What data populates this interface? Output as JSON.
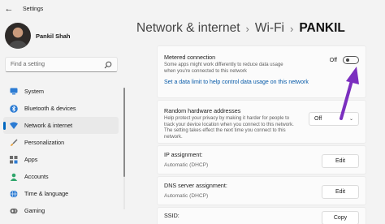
{
  "window": {
    "title": "Settings",
    "back_icon": "back-arrow-icon"
  },
  "profile": {
    "name": "Pankil Shah"
  },
  "search": {
    "placeholder": "Find a setting",
    "icon": "search-icon"
  },
  "nav": {
    "items": [
      {
        "label": "System",
        "icon": "system-icon",
        "color": "#2b7bd3",
        "selected": false
      },
      {
        "label": "Bluetooth & devices",
        "icon": "bluetooth-icon",
        "color": "#2b7bd3",
        "selected": false
      },
      {
        "label": "Network & internet",
        "icon": "wifi-icon",
        "color": "#2b7bd3",
        "selected": true
      },
      {
        "label": "Personalization",
        "icon": "paintbrush-icon",
        "color": "#e8a03a",
        "selected": false
      },
      {
        "label": "Apps",
        "icon": "apps-icon",
        "color": "#6c6c6c",
        "selected": false
      },
      {
        "label": "Accounts",
        "icon": "accounts-icon",
        "color": "#2fa56b",
        "selected": false
      },
      {
        "label": "Time & language",
        "icon": "globe-icon",
        "color": "#2b7bd3",
        "selected": false
      },
      {
        "label": "Gaming",
        "icon": "gaming-icon",
        "color": "#6c6c6c",
        "selected": false
      }
    ]
  },
  "breadcrumb": {
    "level1": "Network & internet",
    "level2": "Wi-Fi",
    "current": "PANKIL"
  },
  "metered": {
    "title": "Metered connection",
    "desc": "Some apps might work differently to reduce data usage when you're connected to this network",
    "toggle_label": "Off",
    "toggle_state": "off",
    "link": "Set a data limit to help control data usage on this network"
  },
  "random_hw": {
    "title": "Random hardware addresses",
    "desc": "Help protect your privacy by making it harder for people to track your device location when you connect to this network. The setting takes effect the next time you connect to this network.",
    "selected": "Off"
  },
  "ip": {
    "title": "IP assignment:",
    "value": "Automatic (DHCP)",
    "button": "Edit"
  },
  "dns": {
    "title": "DNS server assignment:",
    "value": "Automatic (DHCP)",
    "button": "Edit"
  },
  "ssid": {
    "title": "SSID:",
    "button": "Copy"
  },
  "annotation": {
    "arrow_color": "#7b2fbf"
  }
}
